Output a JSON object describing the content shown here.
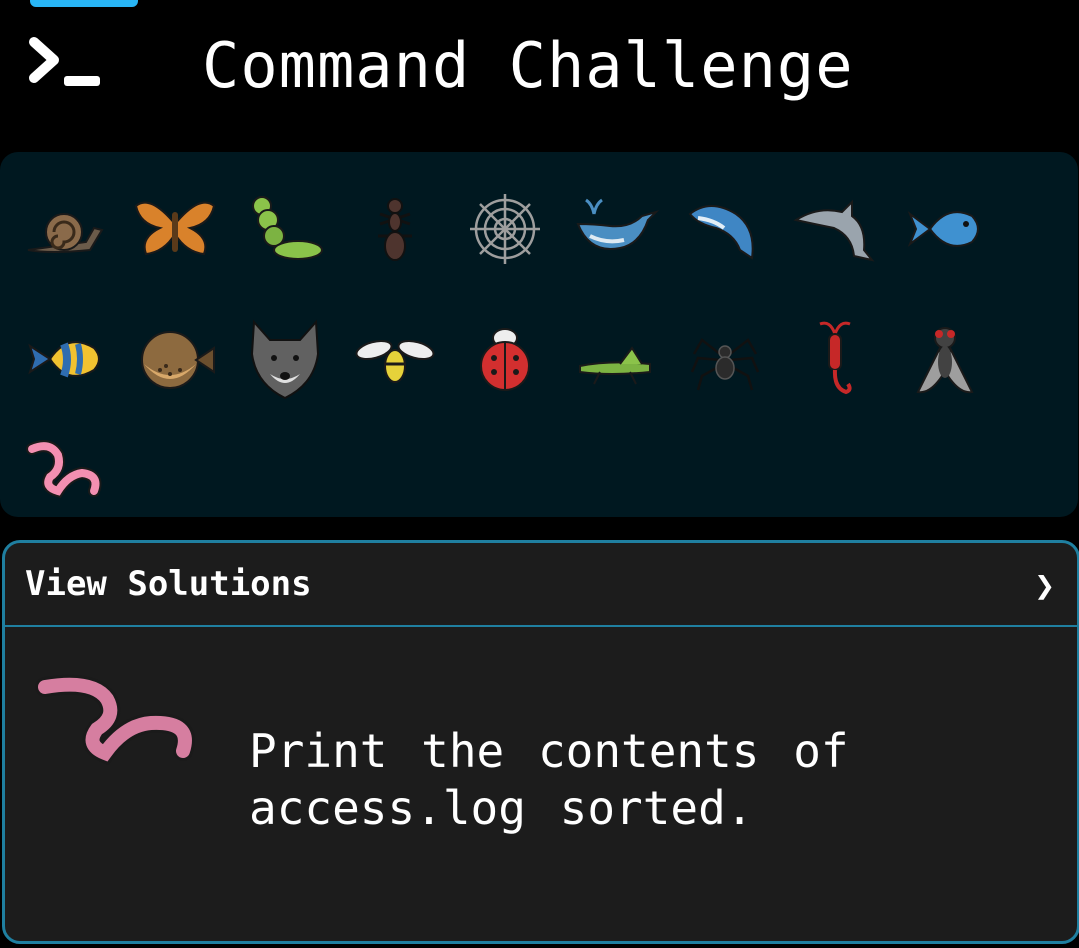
{
  "header": {
    "title": "Command Challenge",
    "logo_icon": "terminal-prompt-icon"
  },
  "challenge_icons": [
    [
      "snail-icon",
      "butterfly-icon",
      "caterpillar-icon",
      "ant-icon",
      "spider-web-icon",
      "whale-icon",
      "orca-icon",
      "dolphin-icon",
      "fish-icon"
    ],
    [
      "tropical-fish-icon",
      "pufferfish-icon",
      "wolf-icon",
      "bee-icon",
      "ladybug-icon",
      "grasshopper-icon",
      "spider-icon",
      "scorpion-icon",
      "fly-icon"
    ],
    [
      "worm-icon"
    ]
  ],
  "card": {
    "header_label": "View Solutions",
    "chevron": "❯",
    "icon": "worm-icon",
    "challenge_text": "Print the contents of\naccess.log sorted."
  },
  "colors": {
    "background": "#000000",
    "panel": "#001820",
    "card": "#1c1c1c",
    "accent": "#1f7fa0",
    "tab_indicator": "#29b6f6"
  }
}
